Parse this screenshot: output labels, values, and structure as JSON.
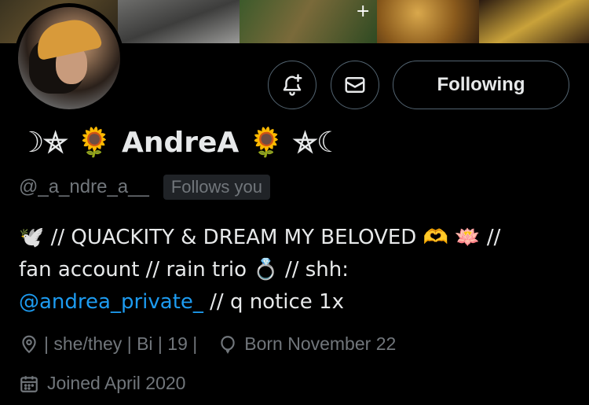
{
  "banner": {
    "plus_glyph": "+"
  },
  "actions": {
    "follow_label": "Following"
  },
  "profile": {
    "display_name": "☽⛤ 🌻 AndreA 🌻 ⛤☾",
    "handle": "@_a_ndre_a__",
    "follows_you": "Follows you",
    "bio_line1": "🕊️ // QUACKITY & DREAM MY BELOVED 🫶 🪷 //",
    "bio_line2": "fan account // rain trio 💍 // shh:",
    "bio_mention": "@andrea_private_",
    "bio_line3_rest": " // q notice 1x",
    "location": "| she/they | Bi | 19 |",
    "birthday": "Born November 22",
    "joined": "Joined April 2020"
  },
  "icons": {
    "notification": "bell-plus-icon",
    "message": "envelope-icon",
    "location": "location-pin-icon",
    "birthday": "balloon-icon",
    "joined": "calendar-icon"
  },
  "colors": {
    "background": "#000000",
    "text": "#e7e9ea",
    "secondary": "#71767b",
    "link": "#1d9bf0",
    "border": "#536471"
  }
}
